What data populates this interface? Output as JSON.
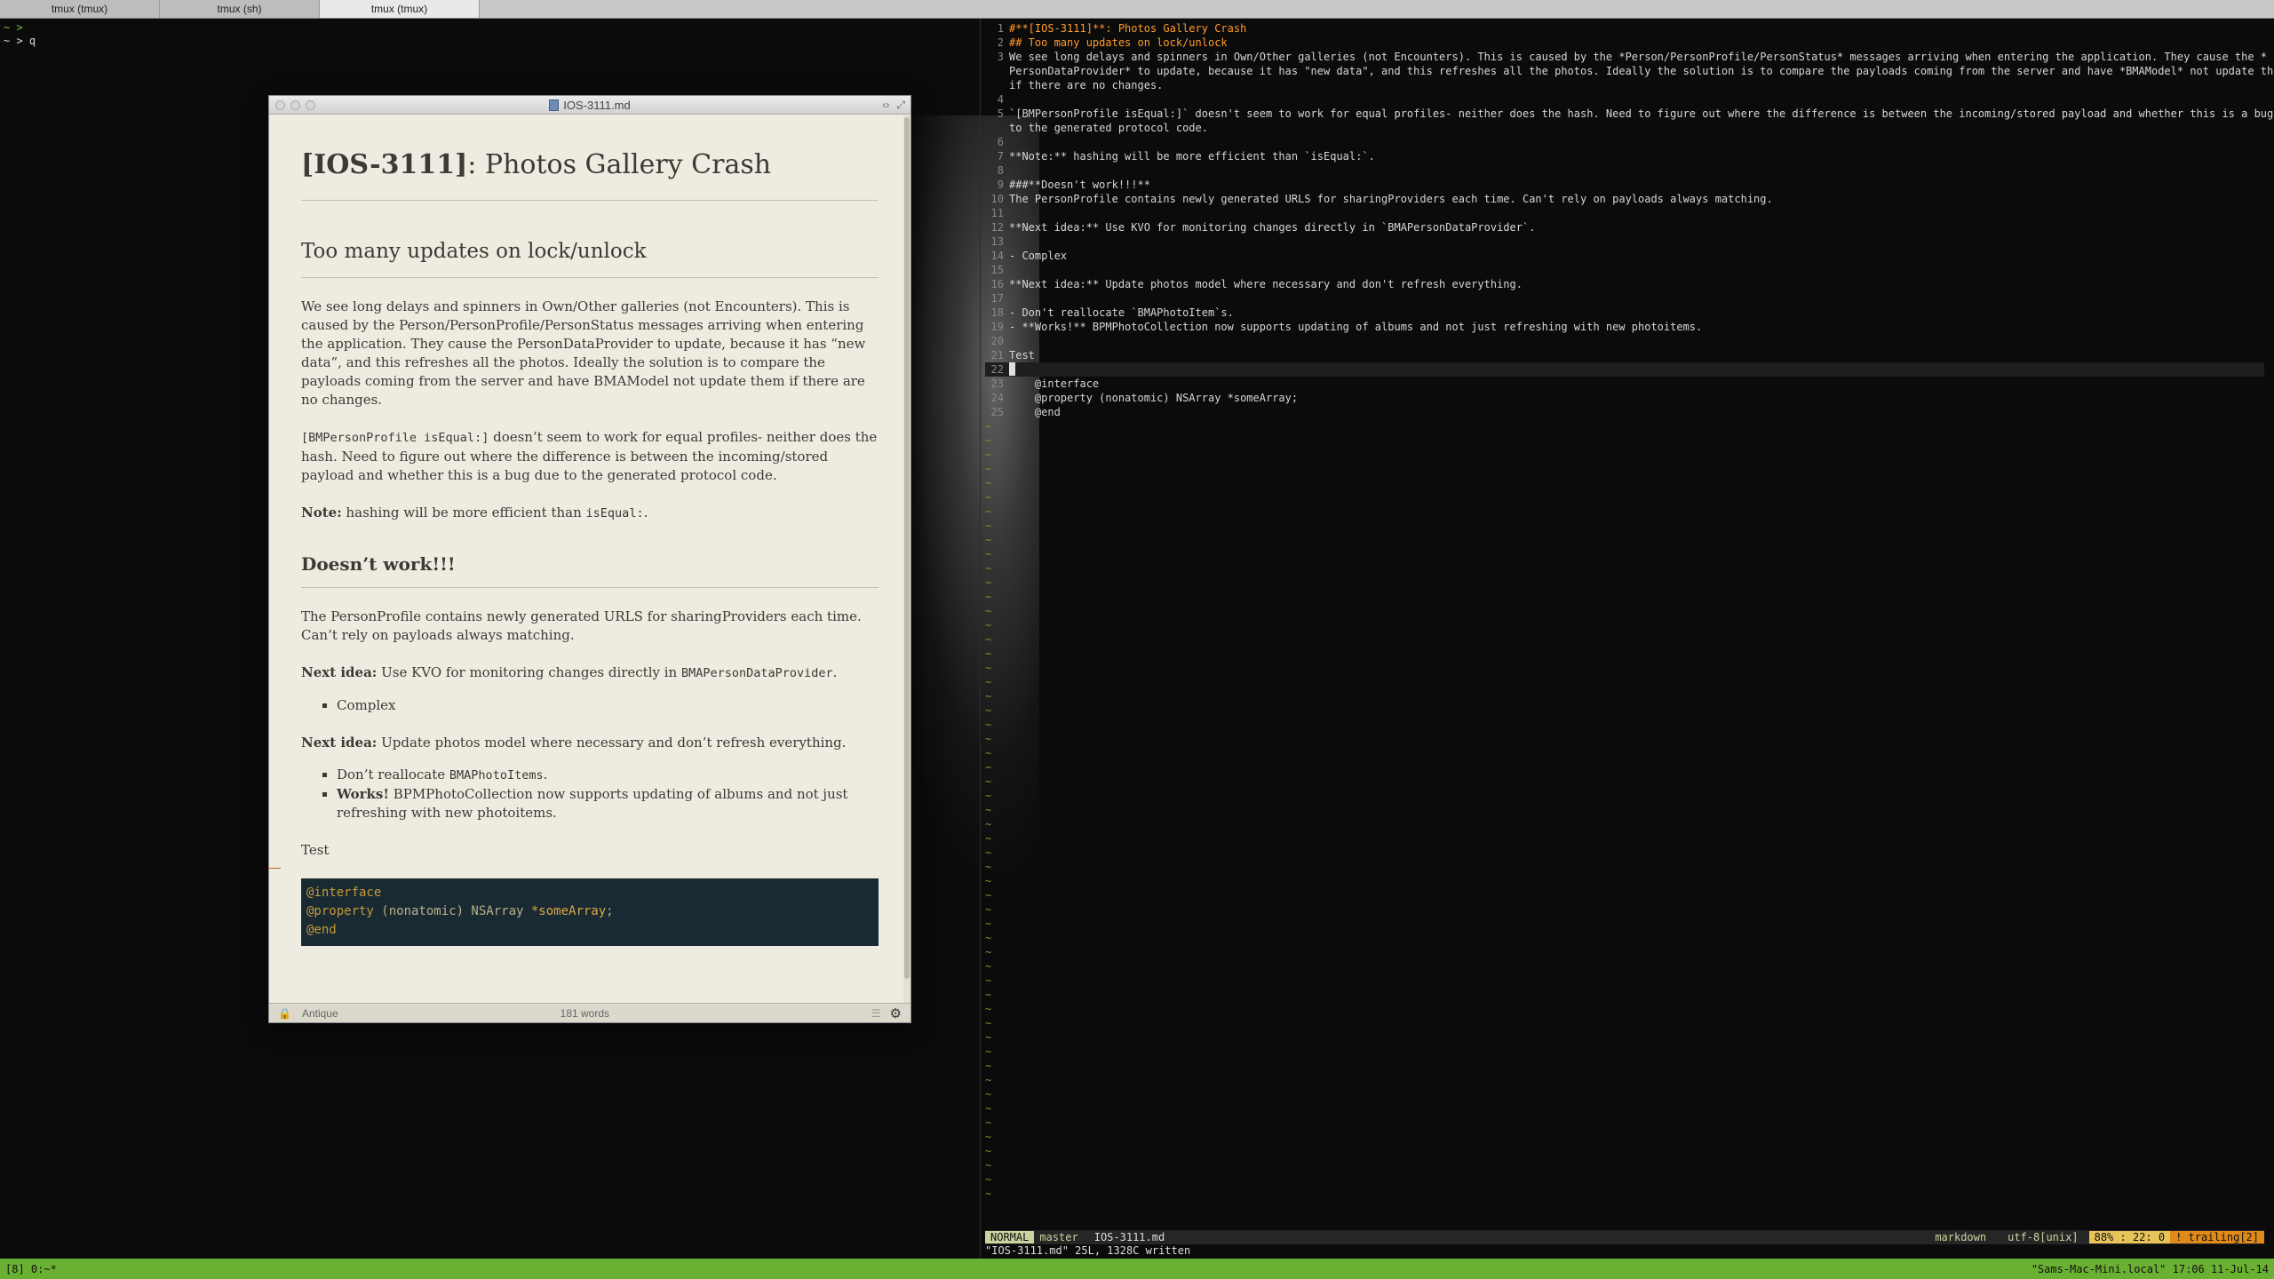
{
  "tabs": [
    "tmux (tmux)",
    "tmux (sh)",
    "tmux (tmux)"
  ],
  "shell_lines": [
    "~ >",
    "~ > q"
  ],
  "marked": {
    "title": "IOS-3111.md",
    "h1_bold": "[IOS-3111]",
    "h1_rest": ": Photos Gallery Crash",
    "h2": "Too many updates on lock/unlock",
    "p1": "We see long delays and spinners in Own/Other galleries (not Encounters). This is caused by the Person/PersonProfile/PersonStatus messages arriving when entering the application. They cause the PersonDataProvider to update, because it has “new data”, and this refreshes all the photos. Ideally the solution is to compare the payloads coming from the server and have BMAModel not update them if there are no changes.",
    "p2_code": "[BMPersonProfile isEqual:]",
    "p2_rest": " doesn’t seem to work for equal profiles- neither does the hash. Need to figure out where the difference is between the incoming/stored payload and whether this is a bug due to the generated protocol code.",
    "p3_bold": "Note:",
    "p3_rest": " hashing will be more efficient than ",
    "p3_code": "isEqual:",
    "p3_end": ".",
    "h3": "Doesn’t work!!!",
    "p4": "The PersonProfile contains newly generated URLS for sharingProviders each time. Can’t rely on payloads always matching.",
    "p5_bold": "Next idea:",
    "p5_rest": " Use KVO for monitoring changes directly in ",
    "p5_code": "BMAPersonDataProvider",
    "p5_end": ".",
    "li1": "Complex",
    "p6_bold": "Next idea:",
    "p6_rest": " Update photos model where necessary and don’t refresh everything.",
    "li2_text": "Don’t reallocate ",
    "li2_code": "BMAPhotoItems",
    "li2_end": ".",
    "li3_bold": "Works!",
    "li3_rest": " BPMPhotoCollection now supports updating of albums and not just refreshing with new photoitems.",
    "p7": "Test",
    "code_l1": "@interface",
    "code_l2a": "@property",
    "code_l2b": " (nonatomic) NSArray ",
    "code_l2c": "*someArray",
    "code_l2d": ";",
    "code_l3": "@end",
    "status_theme": "Antique",
    "status_words": "181 words"
  },
  "vim": {
    "lines": [
      {
        "n": "1",
        "t": "#**[IOS-3111]**: Photos Gallery Crash",
        "h": true
      },
      {
        "n": "2",
        "t": "## Too many updates on lock/unlock",
        "h": true
      },
      {
        "n": "3",
        "t": "We see long delays and spinners in Own/Other galleries (not Encounters). This is caused by the *Person/PersonProfile/PersonStatus* messages arriving when entering the application. They cause the *"
      },
      {
        "n": "",
        "t": "PersonDataProvider* to update, because it has \"new data\", and this refreshes all the photos. Ideally the solution is to compare the payloads coming from the server and have *BMAModel* not update them"
      },
      {
        "n": "",
        "t": "if there are no changes."
      },
      {
        "n": "4",
        "t": ""
      },
      {
        "n": "5",
        "t": "`[BMPersonProfile isEqual:]` doesn't seem to work for equal profiles- neither does the hash. Need to figure out where the difference is between the incoming/stored payload and whether this is a bug due"
      },
      {
        "n": "",
        "t": "to the generated protocol code."
      },
      {
        "n": "6",
        "t": ""
      },
      {
        "n": "7",
        "t": "**Note:** hashing will be more efficient than `isEqual:`."
      },
      {
        "n": "8",
        "t": ""
      },
      {
        "n": "9",
        "t": "###**Doesn't work!!!**"
      },
      {
        "n": "10",
        "t": "The PersonProfile contains newly generated URLS for sharingProviders each time. Can't rely on payloads always matching."
      },
      {
        "n": "11",
        "t": ""
      },
      {
        "n": "12",
        "t": "**Next idea:** Use KVO for monitoring changes directly in `BMAPersonDataProvider`."
      },
      {
        "n": "13",
        "t": ""
      },
      {
        "n": "14",
        "t": "- Complex"
      },
      {
        "n": "15",
        "t": ""
      },
      {
        "n": "16",
        "t": "**Next idea:** Update photos model where necessary and don't refresh everything."
      },
      {
        "n": "17",
        "t": ""
      },
      {
        "n": "18",
        "t": "- Don't reallocate `BMAPhotoItem`s."
      },
      {
        "n": "19",
        "t": "- **Works!** BPMPhotoCollection now supports updating of albums and not just refreshing with new photoitems."
      },
      {
        "n": "20",
        "t": ""
      },
      {
        "n": "21",
        "t": "Test"
      },
      {
        "n": "22",
        "t": "",
        "cursor": true
      },
      {
        "n": "23",
        "t": "    @interface"
      },
      {
        "n": "24",
        "t": "    @property (nonatomic) NSArray *someArray;"
      },
      {
        "n": "25",
        "t": "    @end"
      }
    ],
    "tilde_count": 55,
    "status_mode": "NORMAL",
    "status_branch": "master",
    "status_file": "IOS-3111.md",
    "status_ft": "markdown",
    "status_enc": "utf-8[unix]",
    "status_pos": "88% :  22:  0",
    "status_warn": "! trailing[2]",
    "message": "\"IOS-3111.md\" 25L, 1328C written"
  },
  "tmux": {
    "left": "[8] 0:~*",
    "right": "\"Sams-Mac-Mini.local\" 17:06 11-Jul-14"
  }
}
